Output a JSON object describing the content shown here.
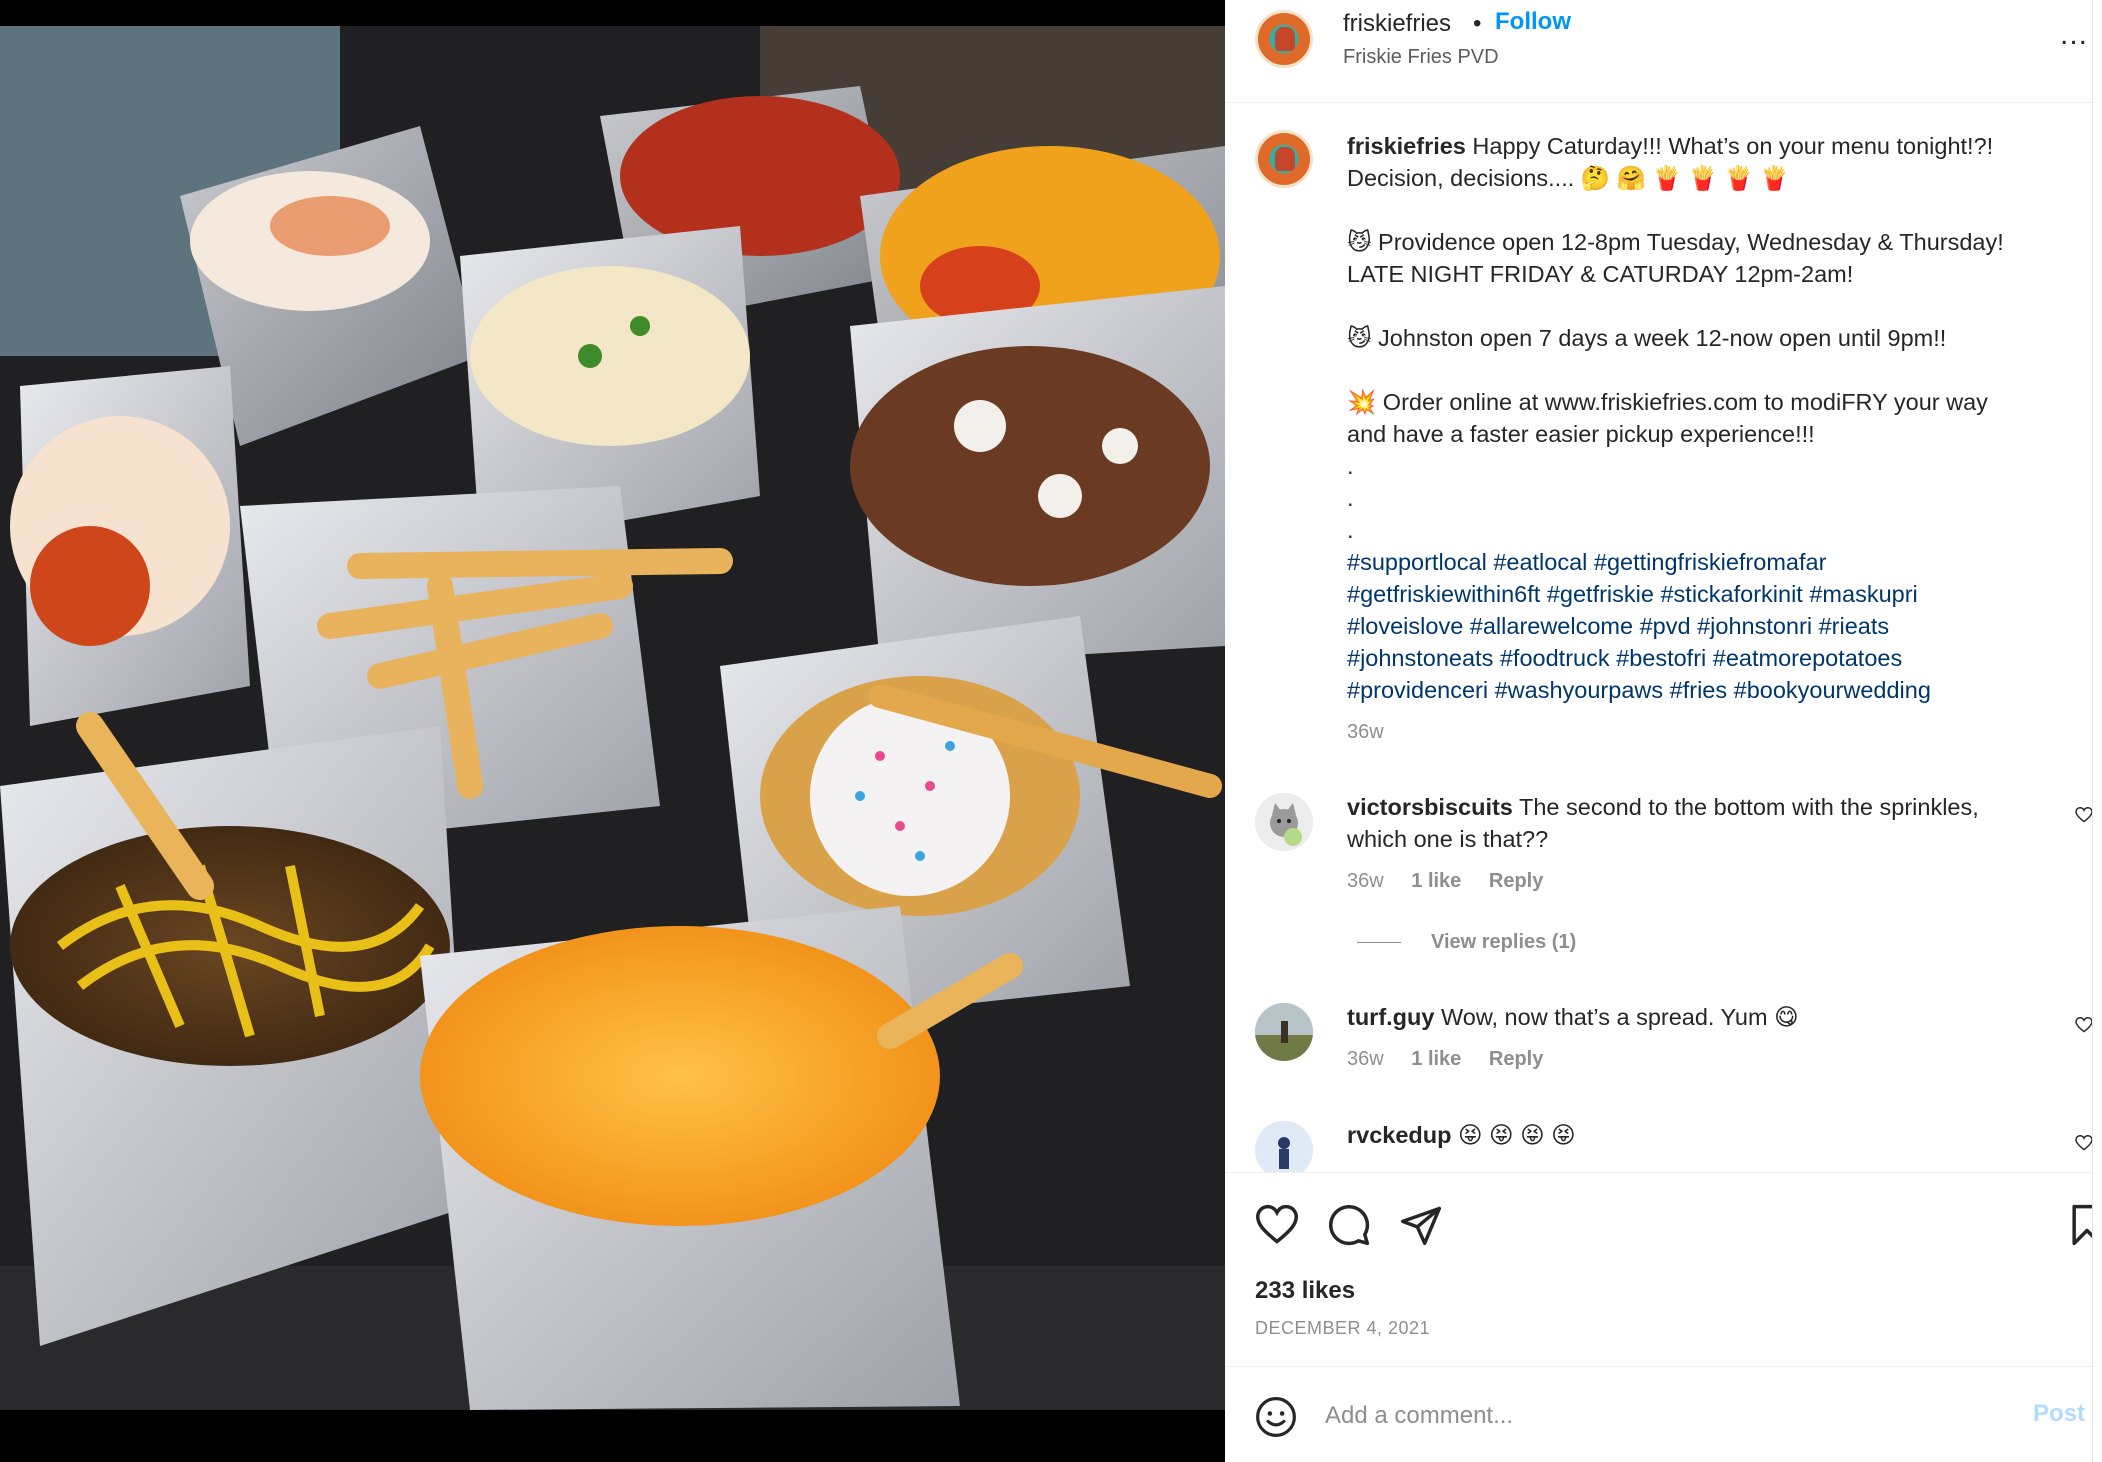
{
  "post": {
    "header": {
      "username": "friskiefries",
      "separator": "•",
      "follow_label": "Follow",
      "location": "Friskie Fries PVD",
      "more_label": "..."
    },
    "caption": {
      "username": "friskiefries",
      "line1": "Happy Caturday!!! What’s on your menu tonight!?!",
      "line2": "Decision, decisions.... 🤔 🤗 🍟 🍟 🍟 🍟",
      "line3": "😼 Providence open 12-8pm Tuesday, Wednesday & Thursday!",
      "line4": "LATE NIGHT FRIDAY & CATURDAY 12pm-2am!",
      "line5": "😼 Johnston open 7 days a week 12-now open until 9pm!!",
      "line6": "💥 Order online at www.friskiefries.com to modiFRY your way",
      "line7": "and have a faster easier pickup experience!!!",
      "dot": ".",
      "hashtags1": "#supportlocal #eatlocal #gettingfriskiefromafar",
      "hashtags2": "#getfriskiewithin6ft #getfriskie #stickaforkinit #maskupri",
      "hashtags3": "#loveislove #allarewelcome #pvd #johnstonri #rieats",
      "hashtags4": "#johnstoneats #foodtruck #bestofri #eatmorepotatoes",
      "hashtags5": "#providenceri #washyourpaws #fries #bookyourwedding",
      "time": "36w"
    },
    "comments": [
      {
        "username": "victorsbiscuits",
        "text1": "The second to the bottom with the sprinkles,",
        "text2": "which one is that??",
        "time": "36w",
        "likes": "1 like",
        "reply": "Reply",
        "view_replies": "View replies (1)"
      },
      {
        "username": "turf.guy",
        "text1": "Wow, now that’s a spread. Yum 😋",
        "time": "36w",
        "likes": "1 like",
        "reply": "Reply"
      },
      {
        "username": "rvckedup",
        "text1": "😝 😝 😝 😝"
      }
    ],
    "likes_count": "233 likes",
    "date": "DECEMBER 4, 2021",
    "add_comment": {
      "placeholder": "Add a comment...",
      "post_label": "Post"
    }
  },
  "icons": {
    "like": "heart-icon",
    "comment": "speech-bubble-icon",
    "share": "paper-plane-icon",
    "save": "bookmark-icon",
    "emoji": "smiley-icon"
  },
  "colors": {
    "link_blue": "#0095f6",
    "hashtag": "#00376b",
    "muted": "#8e8e8e",
    "post_disabled": "#b3dbff"
  }
}
